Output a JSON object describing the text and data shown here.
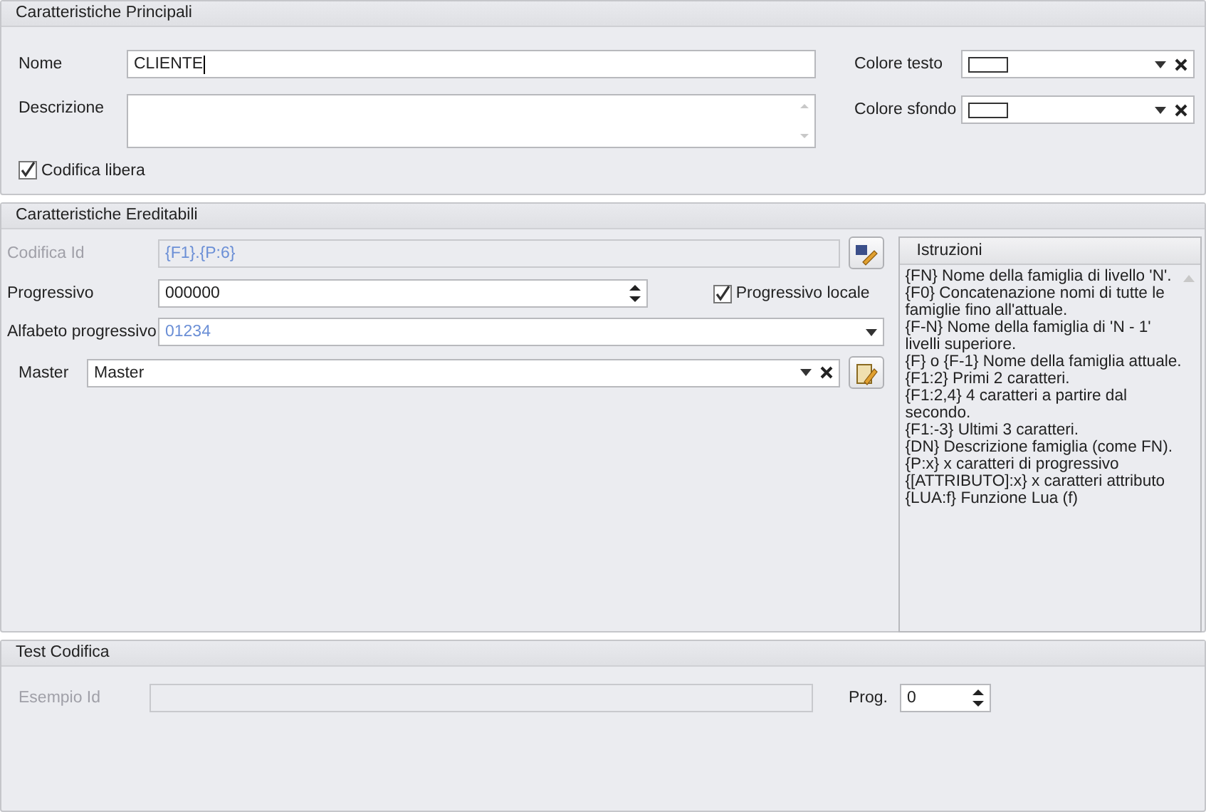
{
  "principali": {
    "title": "Caratteristiche Principali",
    "nome": {
      "label": "Nome",
      "value": "CLIENTE"
    },
    "descrizione": {
      "label": "Descrizione"
    },
    "colore_testo": {
      "label": "Colore testo"
    },
    "colore_sfondo": {
      "label": "Colore sfondo"
    },
    "codifica_libera": {
      "label": "Codifica libera",
      "checked": true
    }
  },
  "ereditabili": {
    "title": "Caratteristiche Ereditabili",
    "codifica_id": {
      "label": "Codifica Id",
      "value": "{F1}.{P:6}",
      "disabled": true
    },
    "progressivo": {
      "label": "Progressivo",
      "value": "000000"
    },
    "progressivo_locale": {
      "label": "Progressivo locale",
      "checked": true
    },
    "alfabeto": {
      "label": "Alfabeto progressivo",
      "value": "01234"
    },
    "master": {
      "label": "Master",
      "value": "Master"
    },
    "istruzioni": {
      "title": "Istruzioni",
      "lines": [
        "{FN} Nome della famiglia di livello 'N'.",
        "{F0} Concatenazione nomi di tutte le famiglie fino all'attuale.",
        "{F-N} Nome della famiglia di 'N - 1' livelli superiore.",
        "{F} o {F-1} Nome della famiglia attuale.",
        "{F1:2} Primi 2 caratteri.",
        "{F1:2,4} 4 caratteri a partire dal secondo.",
        "{F1:-3} Ultimi 3 caratteri.",
        "{DN} Descrizione famiglia (come FN).",
        "{P:x} x caratteri di progressivo",
        "{[ATTRIBUTO]:x} x caratteri attributo",
        "{LUA:f} Funzione Lua (f)"
      ]
    }
  },
  "test": {
    "title": "Test Codifica",
    "esempio_id": {
      "label": "Esempio Id",
      "disabled": true
    },
    "prog": {
      "label": "Prog.",
      "value": "0"
    }
  }
}
